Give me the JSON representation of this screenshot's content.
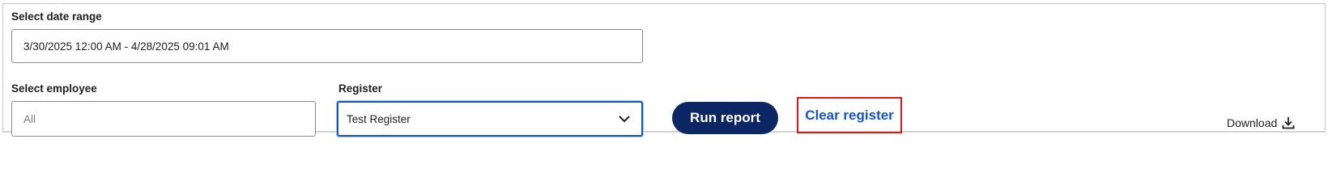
{
  "date_range": {
    "label": "Select date range",
    "value": "3/30/2025 12:00 AM - 4/28/2025 09:01 AM"
  },
  "employee": {
    "label": "Select employee",
    "placeholder": "All"
  },
  "register": {
    "label": "Register",
    "selected": "Test Register",
    "chevron_icon": "chevron-down"
  },
  "actions": {
    "run_report": "Run report",
    "clear_register": "Clear register",
    "download": "Download",
    "download_icon": "download-arrow"
  },
  "colors": {
    "primary_button": "#0c2663",
    "link": "#1656c4",
    "highlight_box": "#e01818",
    "select_focus_border": "#1a56b8"
  }
}
